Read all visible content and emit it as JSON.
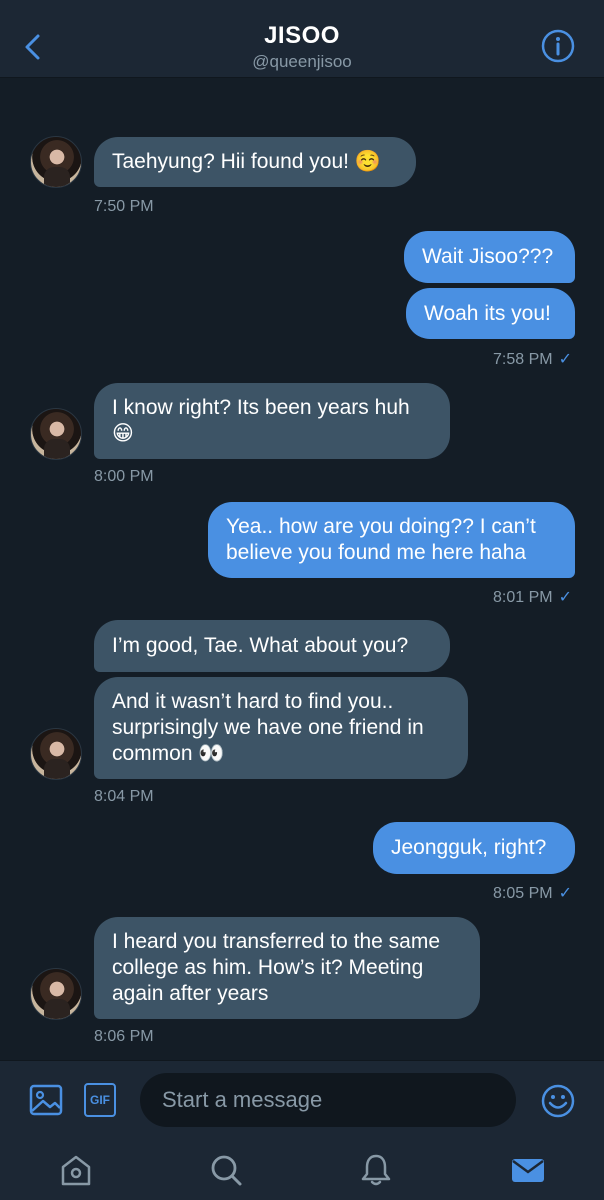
{
  "header": {
    "title": "JISOO",
    "handle": "@queenjisoo"
  },
  "messages": [
    {
      "from": "them",
      "text": "Taehyung? Hii found you! ☺️"
    },
    {
      "time": "7:50 PM"
    },
    {
      "from": "me",
      "text": "Wait Jisoo???"
    },
    {
      "from": "me",
      "text": "Woah its you!"
    },
    {
      "time": "7:58 PM"
    },
    {
      "from": "them",
      "text": "I know right? Its been years huh\n😁"
    },
    {
      "time": "8:00 PM"
    },
    {
      "from": "me",
      "text": "Yea.. how are you doing?? I can’t\nbelieve you found me here haha"
    },
    {
      "time": "8:01 PM"
    },
    {
      "from": "them",
      "text": "I’m good, Tae. What about you?"
    },
    {
      "from": "them",
      "text": "And it wasn’t hard to find you..\nsurprisingly we have one friend in\ncommon 👀"
    },
    {
      "time": "8:04 PM"
    },
    {
      "from": "me",
      "text": "Jeongguk, right?"
    },
    {
      "time": "8:05 PM"
    },
    {
      "from": "them",
      "text": "I heard you transferred to the same\ncollege as him. How’s it? Meeting\nagain after years"
    },
    {
      "time": "8:06 PM"
    }
  ],
  "composer": {
    "placeholder": "Start a message",
    "gif_label": "GIF"
  },
  "read_check": "✓",
  "icons": {
    "back": "chevron-left-icon",
    "info": "info-icon",
    "image": "image-icon",
    "emoji": "emoji-icon",
    "home": "home-icon",
    "search": "search-icon",
    "notifications": "bell-icon",
    "messages": "mail-icon"
  },
  "colors": {
    "background": "#141d26",
    "bar": "#1c2734",
    "incoming_bubble": "#3d5466",
    "outgoing_bubble": "#4a90e2",
    "accent": "#4a90e2",
    "muted_text": "#8899a6"
  }
}
